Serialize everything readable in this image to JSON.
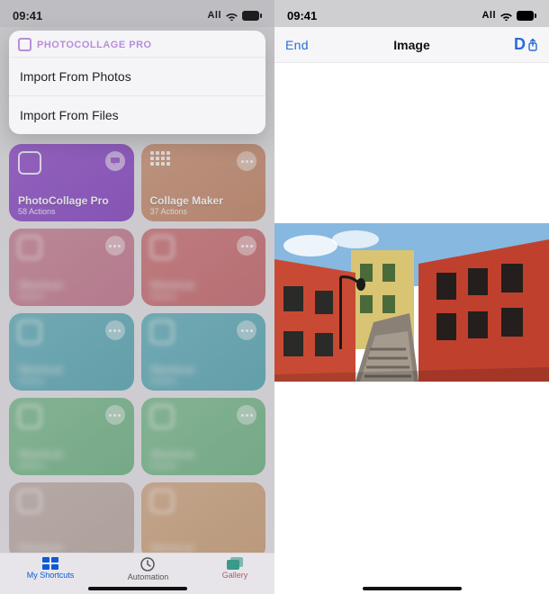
{
  "status": {
    "time": "09:41",
    "carrier": "All"
  },
  "left": {
    "sheet": {
      "app": "PHOTOCOLLAGE PRO",
      "items": [
        "Import From Photos",
        "Import From Files"
      ]
    },
    "cards": [
      {
        "title": "PhotoCollage Pro",
        "sub": "58 Actions"
      },
      {
        "title": "Collage Maker",
        "sub": "37 Actions"
      }
    ],
    "tabs": {
      "mine": "My Shortcuts",
      "auto": "Automation",
      "gallery": "Gallery"
    }
  },
  "right": {
    "back": "End",
    "title": "Image",
    "done": "D"
  }
}
